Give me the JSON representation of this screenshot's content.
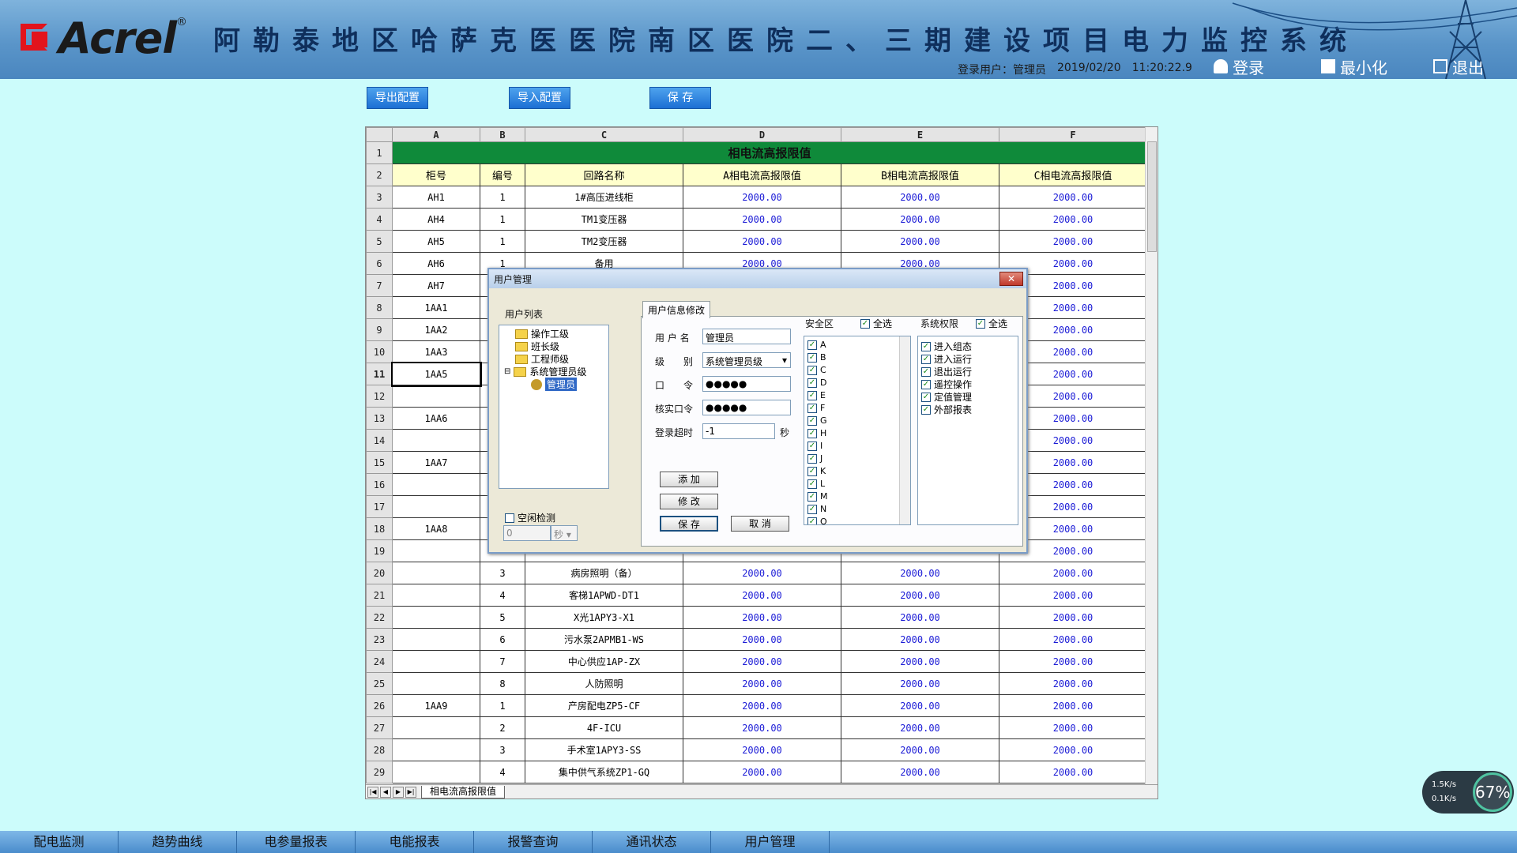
{
  "header": {
    "brand": "Acrel",
    "reg": "®",
    "title": "阿勒泰地区哈萨克医医院南区医院二、三期建设项目电力监控系统",
    "user_label": "登录用户：",
    "user_name": "管理员",
    "date": "2019/02/20",
    "time": "11:20:22.9",
    "login": "登录",
    "minimize": "最小化",
    "exit": "退出"
  },
  "toolbar": {
    "export": "导出配置",
    "import": "导入配置",
    "save": "保 存"
  },
  "sheet": {
    "columns": [
      "A",
      "B",
      "C",
      "D",
      "E",
      "F"
    ],
    "title": "相电流高报限值",
    "headers": [
      "柜号",
      "编号",
      "回路名称",
      "A相电流高报限值",
      "B相电流高报限值",
      "C相电流高报限值"
    ],
    "tab": "相电流高报限值",
    "rows": [
      {
        "n": "3",
        "cab": "AH1",
        "no": "1",
        "name": "1#高压进线柜",
        "a": "2000.00",
        "b": "2000.00",
        "c": "2000.00"
      },
      {
        "n": "4",
        "cab": "AH4",
        "no": "1",
        "name": "TM1变压器",
        "a": "2000.00",
        "b": "2000.00",
        "c": "2000.00"
      },
      {
        "n": "5",
        "cab": "AH5",
        "no": "1",
        "name": "TM2变压器",
        "a": "2000.00",
        "b": "2000.00",
        "c": "2000.00"
      },
      {
        "n": "6",
        "cab": "AH6",
        "no": "1",
        "name": "备用",
        "a": "2000.00",
        "b": "2000.00",
        "c": "2000.00"
      },
      {
        "n": "7",
        "cab": "AH7",
        "no": "",
        "name": "",
        "a": "",
        "b": "",
        "c": "2000.00"
      },
      {
        "n": "8",
        "cab": "1AA1",
        "no": "",
        "name": "",
        "a": "",
        "b": "",
        "c": "2000.00"
      },
      {
        "n": "9",
        "cab": "1AA2",
        "no": "",
        "name": "",
        "a": "",
        "b": "",
        "c": "2000.00"
      },
      {
        "n": "10",
        "cab": "1AA3",
        "no": "",
        "name": "",
        "a": "",
        "b": "",
        "c": "2000.00"
      },
      {
        "n": "11",
        "cab": "1AA5",
        "no": "",
        "name": "",
        "a": "",
        "b": "",
        "c": "2000.00"
      },
      {
        "n": "12",
        "cab": "",
        "no": "",
        "name": "",
        "a": "",
        "b": "",
        "c": "2000.00"
      },
      {
        "n": "13",
        "cab": "1AA6",
        "no": "",
        "name": "",
        "a": "",
        "b": "",
        "c": "2000.00"
      },
      {
        "n": "14",
        "cab": "",
        "no": "",
        "name": "",
        "a": "",
        "b": "",
        "c": "2000.00"
      },
      {
        "n": "15",
        "cab": "1AA7",
        "no": "",
        "name": "",
        "a": "",
        "b": "",
        "c": "2000.00"
      },
      {
        "n": "16",
        "cab": "",
        "no": "",
        "name": "",
        "a": "",
        "b": "",
        "c": "2000.00"
      },
      {
        "n": "17",
        "cab": "",
        "no": "",
        "name": "",
        "a": "",
        "b": "",
        "c": "2000.00"
      },
      {
        "n": "18",
        "cab": "1AA8",
        "no": "",
        "name": "",
        "a": "",
        "b": "",
        "c": "2000.00"
      },
      {
        "n": "19",
        "cab": "",
        "no": "",
        "name": "",
        "a": "",
        "b": "",
        "c": "2000.00"
      },
      {
        "n": "20",
        "cab": "",
        "no": "3",
        "name": "病房照明（备）",
        "a": "2000.00",
        "b": "2000.00",
        "c": "2000.00"
      },
      {
        "n": "21",
        "cab": "",
        "no": "4",
        "name": "客梯1APWD-DT1",
        "a": "2000.00",
        "b": "2000.00",
        "c": "2000.00"
      },
      {
        "n": "22",
        "cab": "",
        "no": "5",
        "name": "X光1APY3-X1",
        "a": "2000.00",
        "b": "2000.00",
        "c": "2000.00"
      },
      {
        "n": "23",
        "cab": "",
        "no": "6",
        "name": "污水泵2APMB1-WS",
        "a": "2000.00",
        "b": "2000.00",
        "c": "2000.00"
      },
      {
        "n": "24",
        "cab": "",
        "no": "7",
        "name": "中心供应1AP-ZX",
        "a": "2000.00",
        "b": "2000.00",
        "c": "2000.00"
      },
      {
        "n": "25",
        "cab": "",
        "no": "8",
        "name": "人防照明",
        "a": "2000.00",
        "b": "2000.00",
        "c": "2000.00"
      },
      {
        "n": "26",
        "cab": "1AA9",
        "no": "1",
        "name": "产房配电ZP5-CF",
        "a": "2000.00",
        "b": "2000.00",
        "c": "2000.00"
      },
      {
        "n": "27",
        "cab": "",
        "no": "2",
        "name": "4F-ICU",
        "a": "2000.00",
        "b": "2000.00",
        "c": "2000.00"
      },
      {
        "n": "28",
        "cab": "",
        "no": "3",
        "name": "手术室1APY3-SS",
        "a": "2000.00",
        "b": "2000.00",
        "c": "2000.00"
      },
      {
        "n": "29",
        "cab": "",
        "no": "4",
        "name": "集中供气系统ZP1-GQ",
        "a": "2000.00",
        "b": "2000.00",
        "c": "2000.00"
      }
    ]
  },
  "dialog": {
    "title": "用户管理",
    "close": "✕",
    "user_list_label": "用户列表",
    "tree": [
      "操作工级",
      "班长级",
      "工程师级",
      "系统管理员级",
      "管理员"
    ],
    "idle_check": "空闲检测",
    "idle_value": "0",
    "idle_unit": "秒",
    "tab": "用户信息修改",
    "username_label": "用 户 名",
    "username": "管理员",
    "level_label": "级　　别",
    "level": "系统管理员级",
    "pwd_label": "口　　令",
    "pwd": "●●●●●",
    "confirm_label": "核实口令",
    "confirm": "●●●●●",
    "timeout_label": "登录超时",
    "timeout": "-1",
    "timeout_unit": "秒",
    "add": "添 加",
    "modify": "修 改",
    "save": "保 存",
    "cancel": "取 消",
    "security_label": "安全区",
    "select_all": "全选",
    "security_items": [
      "A",
      "B",
      "C",
      "D",
      "E",
      "F",
      "G",
      "H",
      "I",
      "J",
      "K",
      "L",
      "M",
      "N",
      "O"
    ],
    "perm_label": "系统权限",
    "perm_items": [
      "进入组态",
      "进入运行",
      "退出运行",
      "遥控操作",
      "定值管理",
      "外部报表"
    ]
  },
  "bottomnav": [
    "配电监测",
    "趋势曲线",
    "电参量报表",
    "电能报表",
    "报警查询",
    "通讯状态",
    "用户管理"
  ],
  "net": {
    "up": "1.5K/s",
    "down": "0.1K/s",
    "pct": "67%"
  }
}
